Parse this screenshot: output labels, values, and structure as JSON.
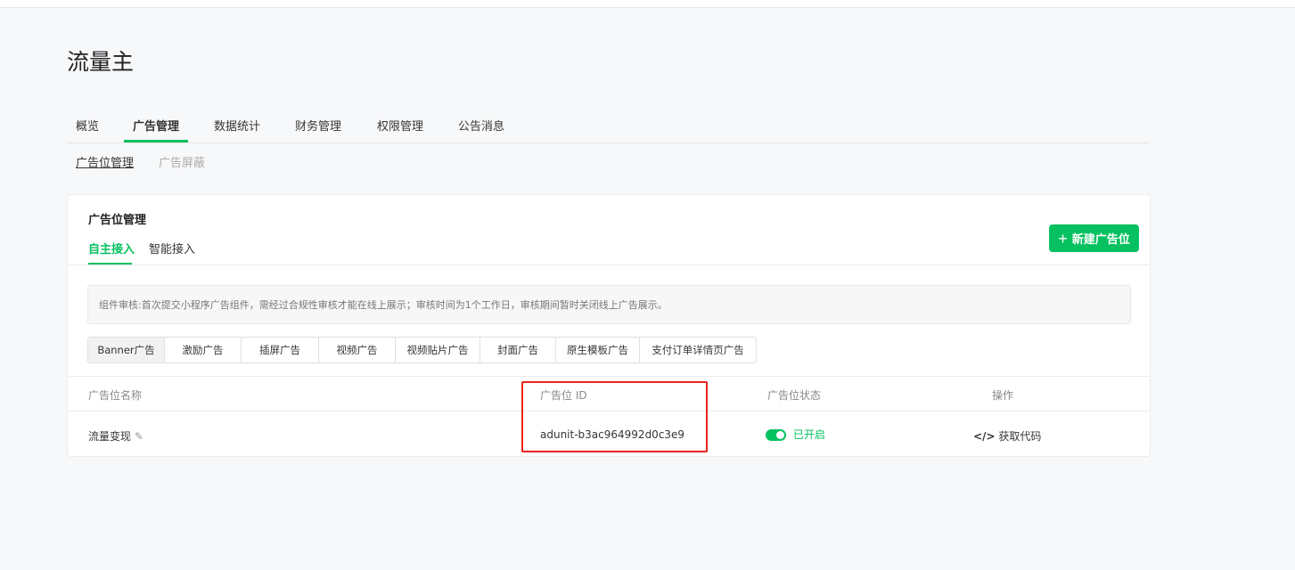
{
  "page_title": "流量主",
  "main_tabs": [
    "概览",
    "广告管理",
    "数据统计",
    "财务管理",
    "权限管理",
    "公告消息"
  ],
  "sub_tabs": [
    "广告位管理",
    "广告屏蔽"
  ],
  "card": {
    "title": "广告位管理",
    "inner_tabs": [
      "自主接入",
      "智能接入"
    ],
    "new_button": "新建广告位",
    "notice": "组件审核:首次提交小程序广告组件，需经过合规性审核才能在线上展示；审核时间为1个工作日，审核期间暂时关闭线上广告展示。",
    "ad_types": [
      "Banner广告",
      "激励广告",
      "插屏广告",
      "视频广告",
      "视频贴片广告",
      "封面广告",
      "原生模板广告",
      "支付订单详情页广告"
    ],
    "table": {
      "headers": [
        "广告位名称",
        "广告位 ID",
        "广告位状态",
        "操作"
      ],
      "rows": [
        {
          "name": "流量变现",
          "id": "adunit-b3ac964992d0c3e9",
          "status": "已开启",
          "action": "获取代码"
        }
      ]
    }
  },
  "colors": {
    "accent": "#07c160",
    "highlight": "#e8231b"
  }
}
